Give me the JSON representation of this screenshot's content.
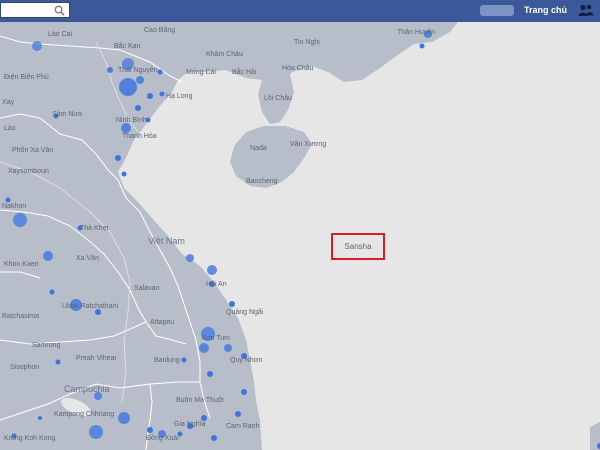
{
  "header": {
    "search_placeholder": "",
    "home_label": "Trang chủ",
    "search_icon": "search-icon",
    "friends_icon": "friends-icon"
  },
  "map": {
    "colors": {
      "land": "#b8bec9",
      "sea": "#e6e6e6",
      "border": "#ffffff",
      "dot": "#3d74e0"
    },
    "labels": {
      "lao_cai": "Lào Cai",
      "cao_bang": "Cao Bằng",
      "bac_kan": "Bắc Kạn",
      "tin_nghi": "Tin Nghị",
      "than_huyen": "Thân Huyên",
      "khanh_son": "Khâm Châu",
      "dien_bien_phu": "Điện Biên Phủ",
      "thai_nguyen": "Thái Nguyên",
      "mong_cai": "Móng Cái",
      "bac_hai": "Bắc Hải",
      "hoa_chau": "Hóa Châu",
      "lao": "Lào",
      "sam_nua": "Sầm Nưa",
      "ha_long": "Hạ Long",
      "ninh_binh": "Ninh Bình",
      "thanh_hoa": "Thanh Hóa",
      "lai_chau": "Lôi Châu",
      "nada": "Nada",
      "van_xuong": "Văn Xương",
      "baocheng": "Baocheng",
      "phon_xa_van": "Phôn Xa Văn",
      "xaysomboun": "Xaysomboun",
      "tha_khet": "Thà Khẹt",
      "viet_nam": "Việt Nam",
      "khon_kaen": "Khon Kaen",
      "xa_van": "Xa Văn",
      "hoi_an": "Hội An",
      "salavan": "Salavan",
      "ubon": "Ubon Ratchathani",
      "quang_ngai": "Quảng Ngãi",
      "attapeu": "Attapeu",
      "kon_tum": "Kon Tum",
      "samrong": "Samrong",
      "preah_vihear": "Preah Vihear",
      "banlung": "Banlung",
      "quy_nhon": "Quy Nhơn",
      "sisophon": "Sisophon",
      "campuchia": "Campuchia",
      "buon_ma_thuot": "Buôn Ma Thuột",
      "kampong_chhnang": "Kampong Chhnang",
      "gia_nghia": "Gia Nghĩa",
      "cam_ranh": "Cam Ranh",
      "koh_kong": "Krong Koh Kong",
      "dong_xoai": "Đồng Xoài",
      "xay": "Xay",
      "nakhon": "Nakhon",
      "ratchasima": "Ratchasima",
      "sansha": "Sansha"
    }
  }
}
